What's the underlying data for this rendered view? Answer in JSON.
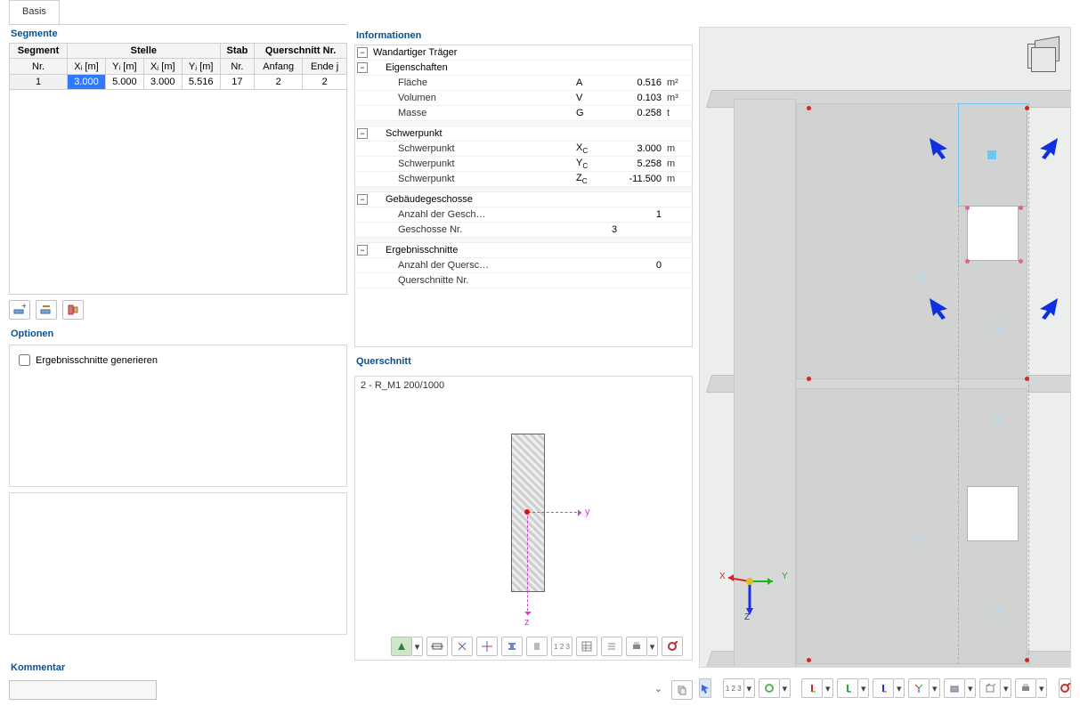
{
  "tabs": {
    "basis": "Basis"
  },
  "panels": {
    "segmente": "Segmente",
    "optionen": "Optionen",
    "informationen": "Informationen",
    "querschnitt": "Querschnitt",
    "kommentar": "Kommentar"
  },
  "seg_table": {
    "headers": {
      "segment": "Segment",
      "nr": "Nr.",
      "stelle": "Stelle",
      "xi": "Xᵢ [m]",
      "yi": "Yᵢ [m]",
      "xj": "Xⱼ [m]",
      "yj": "Yⱼ [m]",
      "stab": "Stab",
      "stab_nr": "Nr.",
      "qs": "Querschnitt Nr.",
      "anfang": "Anfang",
      "ende": "Ende j"
    },
    "rows": [
      {
        "nr": "1",
        "xi": "3.000",
        "yi": "5.000",
        "xj": "3.000",
        "yj": "5.516",
        "stab": "17",
        "anfang": "2",
        "ende": "2"
      }
    ]
  },
  "optionen": {
    "ergebnisschnitte_generieren": "Ergebnisschnitte generieren"
  },
  "info_tree": {
    "wandartiger_traeger": "Wandartiger Träger",
    "eigenschaften": "Eigenschaften",
    "flaeche": {
      "label": "Fläche",
      "sym": "A",
      "val": "0.516",
      "unit": "m²"
    },
    "volumen": {
      "label": "Volumen",
      "sym": "V",
      "val": "0.103",
      "unit": "m³"
    },
    "masse": {
      "label": "Masse",
      "sym": "G",
      "val": "0.258",
      "unit": "t"
    },
    "schwerpunkt": "Schwerpunkt",
    "sp_x": {
      "label": "Schwerpunkt",
      "sym": "Xᶜ",
      "val": "3.000",
      "unit": "m"
    },
    "sp_y": {
      "label": "Schwerpunkt",
      "sym": "Yᶜ",
      "val": "5.258",
      "unit": "m"
    },
    "sp_z": {
      "label": "Schwerpunkt",
      "sym": "Zᶜ",
      "val": "-11.500",
      "unit": "m"
    },
    "geschosse": "Gebäudegeschosse",
    "anz_gesch": {
      "label": "Anzahl der Gesch…",
      "val": "1"
    },
    "gesch_nr": {
      "label": "Geschosse Nr.",
      "val": "3"
    },
    "ergebnisschnitte": "Ergebnisschnitte",
    "anz_qs": {
      "label": "Anzahl der Quersc…",
      "val": "0"
    },
    "qs_nr": {
      "label": "Querschnitte Nr."
    }
  },
  "querschnitt": {
    "name": "2 - R_M1 200/1000",
    "axis_y": "y",
    "axis_z": "z"
  },
  "triad": {
    "x": "X",
    "y": "Y",
    "z": "Z"
  },
  "icons": {
    "add_segment": "+",
    "edit_segment": "✎",
    "delete_segment": "✕"
  }
}
